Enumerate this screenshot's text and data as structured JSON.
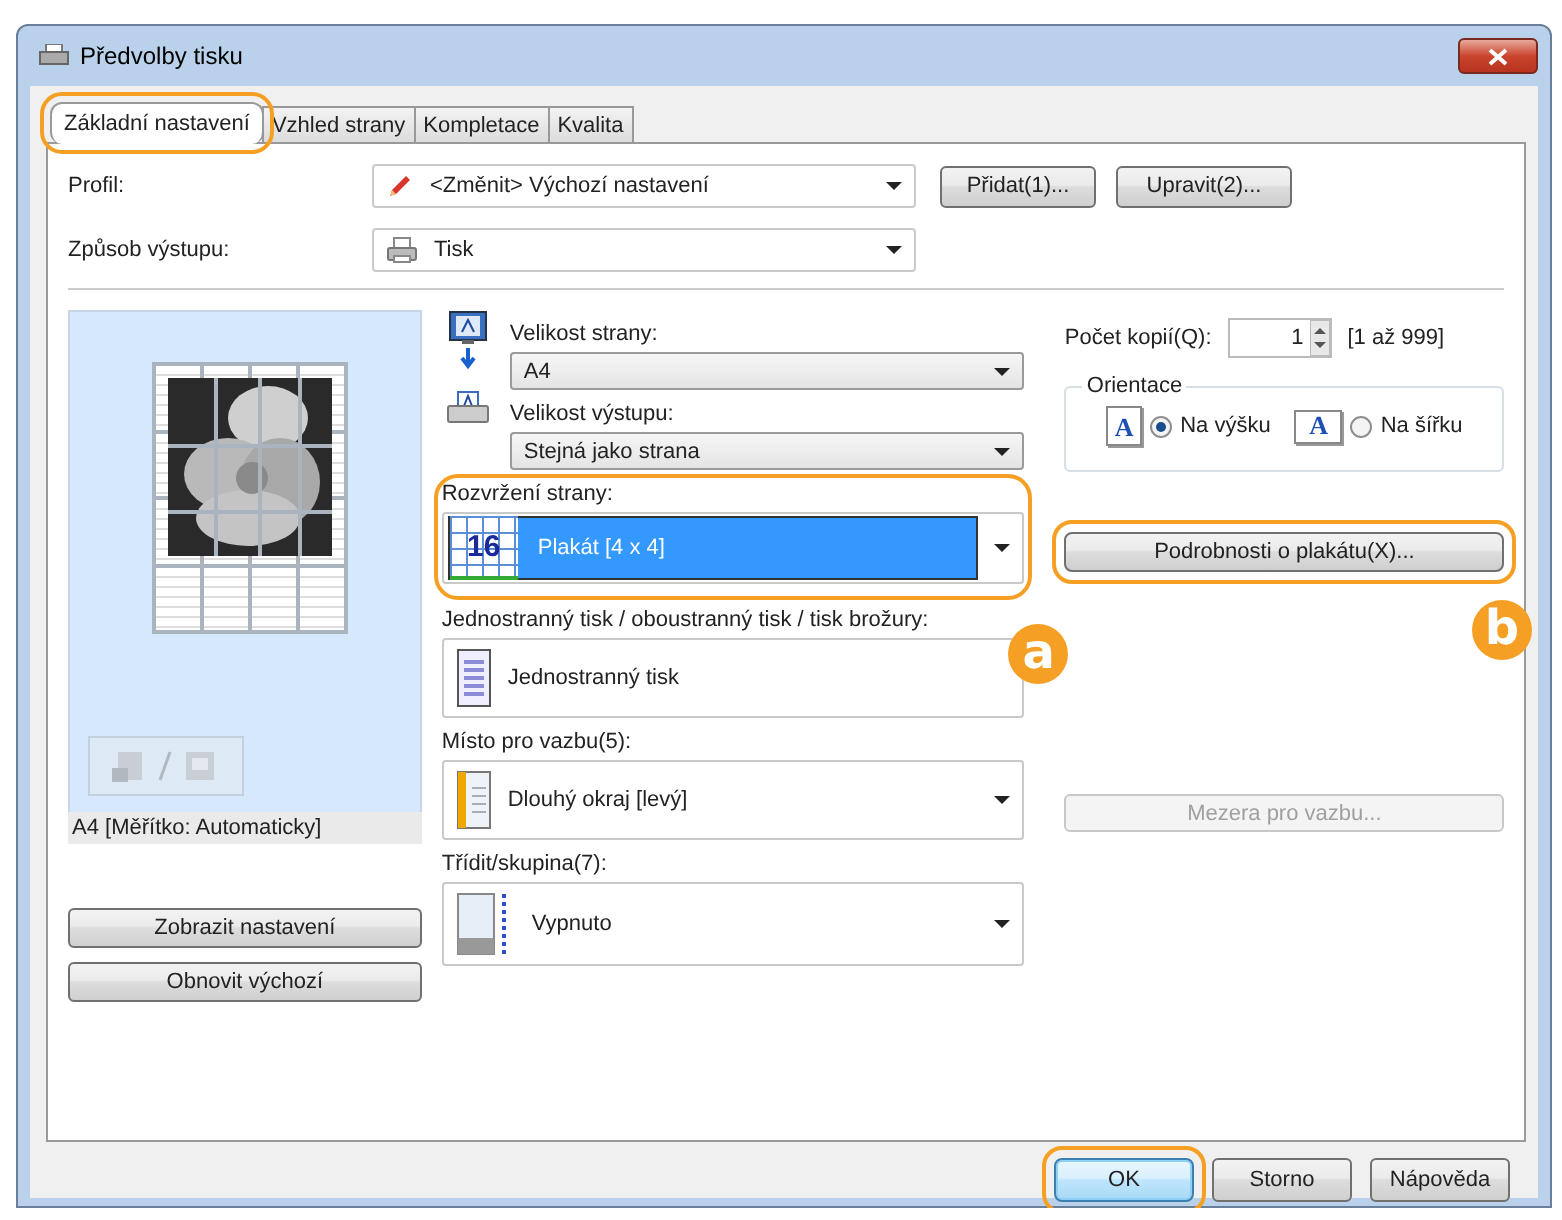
{
  "window": {
    "title": "Předvolby tisku"
  },
  "tabs": [
    {
      "label": "Základní nastavení",
      "selected": true,
      "highlighted": true
    },
    {
      "label": "Vzhled strany",
      "selected": false,
      "highlighted": false
    },
    {
      "label": "Kompletace",
      "selected": false,
      "highlighted": false
    },
    {
      "label": "Kvalita",
      "selected": false,
      "highlighted": false
    }
  ],
  "profile": {
    "label": "Profil:",
    "value": "<Změnit> Výchozí nastavení",
    "buttons": [
      "Přidat(1)...",
      "Upravit(2)..."
    ]
  },
  "output_method": {
    "label": "Způsob výstupu:",
    "value": "Tisk"
  },
  "preview": {
    "caption": "A4 [Měřítko: Automaticky]"
  },
  "preview_buttons": [
    "Zobrazit nastavení",
    "Obnovit výchozí"
  ],
  "page_size": {
    "label": "Velikost strany:",
    "value": "A4"
  },
  "output_size": {
    "label": "Velikost výstupu:",
    "value": "Stejná jako strana"
  },
  "page_layout": {
    "label": "Rozvržení strany:",
    "icon_text": "16",
    "value": "Plakát [4 x 4]",
    "highlighted": true,
    "callout": "a"
  },
  "duplex": {
    "label": "Jednostranný tisk / oboustranný tisk / tisk brožury:",
    "value": "Jednostranný tisk"
  },
  "binding": {
    "label": "Místo pro vazbu(5):",
    "value": "Dlouhý okraj [levý]"
  },
  "collate": {
    "label": "Třídit/skupina(7):",
    "value": "Vypnuto"
  },
  "copies": {
    "label": "Počet kopií(Q):",
    "value": "1",
    "range": "[1 až 999]"
  },
  "orientation": {
    "label": "Orientace",
    "options": [
      {
        "label": "Na výšku",
        "icon_text": "A",
        "selected": true
      },
      {
        "label": "Na šířku",
        "icon_text": "A",
        "selected": false
      }
    ]
  },
  "poster_button": {
    "label": "Podrobnosti o plakátu(X)...",
    "highlighted": true,
    "callout": "b"
  },
  "binding_gap_button": {
    "label": "Mezera pro vazbu...",
    "disabled": true
  },
  "footer_buttons": [
    {
      "label": "OK",
      "highlighted": true,
      "default": true
    },
    {
      "label": "Storno",
      "highlighted": false,
      "default": false
    },
    {
      "label": "Nápověda",
      "highlighted": false,
      "default": false
    }
  ]
}
